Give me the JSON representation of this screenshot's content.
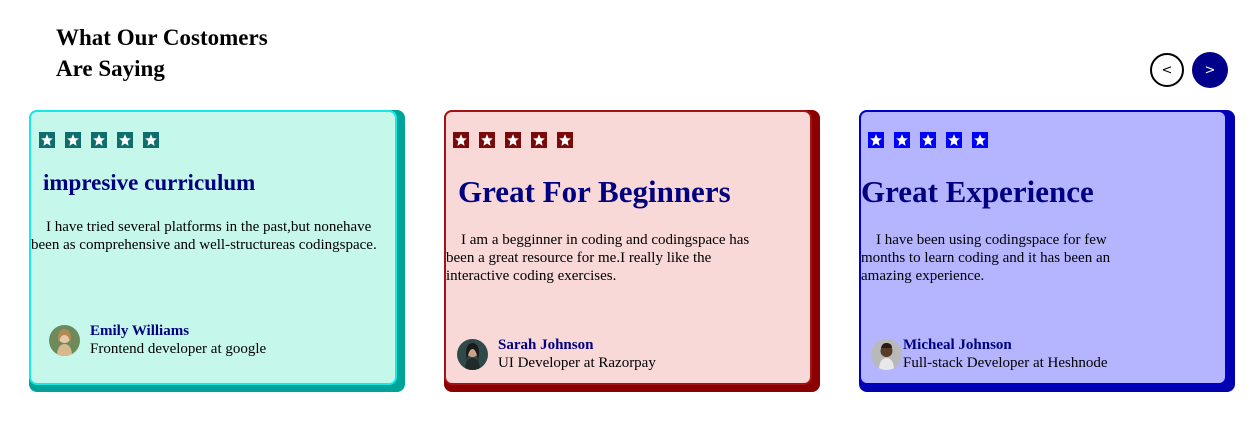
{
  "heading": {
    "line1": "What Our Costomers",
    "line2": "Are Saying"
  },
  "nav": {
    "prev": "<",
    "next": ">"
  },
  "cards": [
    {
      "title": "impresive curriculum",
      "text": "I have tried several platforms in the past,but nonehave been as comprehensive and well-structureas codingspace.",
      "name": "Emily Williams",
      "role": "Frontend developer at google",
      "rating": 5
    },
    {
      "title": "Great For Beginners",
      "text": "I am a begginner in coding and codingspace has been a great resource for me.I really like the interactive coding exercises.",
      "name": "Sarah Johnson",
      "role": "UI Developer at Razorpay",
      "rating": 5
    },
    {
      "title": "Great Experience",
      "text": "I have been using codingspace for few months to learn coding and it has been an amazing experience.",
      "name": "Micheal Johnson",
      "role": "Full-stack Developer at Heshnode",
      "rating": 5
    }
  ],
  "colors": {
    "card1_bg": "#c5f8ea",
    "card1_accent": "#00a39a",
    "card2_bg": "#f9d8d8",
    "card2_accent": "#8b0000",
    "card3_bg": "#b4b4ff",
    "card3_accent": "#0000b0",
    "title": "#000080"
  },
  "icons": {
    "star": "star-icon",
    "avatar": "avatar"
  }
}
